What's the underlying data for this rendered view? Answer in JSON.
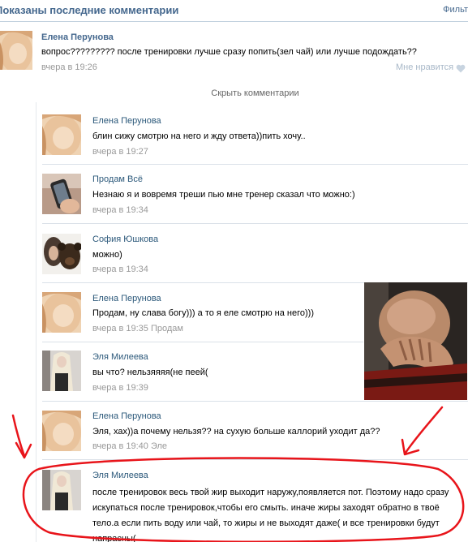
{
  "header": {
    "title": "Показаны последние комментарии",
    "filter": "Фильт"
  },
  "post": {
    "author": "Елена Перунова",
    "text": "вопрос????????? после тренировки лучше сразу попить(зел чай) или лучше подождать??",
    "time": "вчера в 19:26",
    "like_label": "Мне нравится"
  },
  "hide_comments_label": "Скрыть комментарии",
  "comments": [
    {
      "author": "Елена Перунова",
      "text": "блин сижу смотрю на него и жду ответа))пить хочу..",
      "meta": "вчера в 19:27",
      "avatar": "elena"
    },
    {
      "author": "Продам Всё",
      "text": "Незнаю я и вовремя треши пью мне тренер сказал что можно:)",
      "meta": "вчера в 19:34",
      "avatar": "phone"
    },
    {
      "author": "София Юшкова",
      "text": "можно)",
      "meta": "вчера в 19:34",
      "avatar": "sofia"
    },
    {
      "author": "Елена Перунова",
      "text": "Продам, ну слава богу))) а то я еле смотрю на него)))",
      "meta": "вчера в 19:35 Продам",
      "avatar": "elena"
    },
    {
      "author": "Эля Милеева",
      "text": "вы что? нельзяяяя(не пеей(",
      "meta": "вчера в 19:39",
      "avatar": "elya"
    },
    {
      "author": "Елена Перунова",
      "text": "Эля, хах))а почему нельзя?? на сухую больше каллорий уходит да??",
      "meta": "вчера в 19:40 Эле",
      "avatar": "elena"
    },
    {
      "author": "Эля Милеева",
      "text": "после тренировок весь твой жир выходит наружу,появляется пот. Поэтому надо сразу искупаться после тренировок,чтобы его смыть. иначе жиры заходят обратно в твоё тело.а если пить воду или чай, то жиры и не выходят даже( и все тренировки будут напрасны(",
      "meta": "",
      "avatar": "elya"
    }
  ],
  "colors": {
    "link": "#2b587a",
    "header_link": "#45688e",
    "meta": "#999999",
    "annotation": "#e8141a"
  },
  "icons": {
    "like": "heart-icon"
  }
}
